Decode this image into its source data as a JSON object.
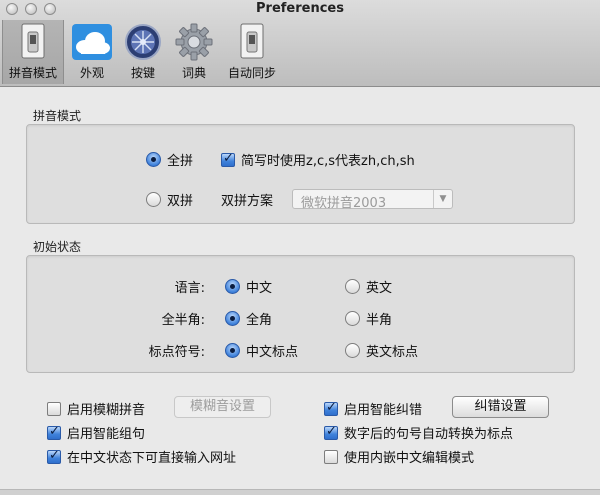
{
  "window": {
    "title": "Preferences"
  },
  "toolbar": {
    "items": [
      {
        "label": "拼音模式",
        "icon": "switch-icon",
        "selected": true
      },
      {
        "label": "外观",
        "icon": "cloud-icon",
        "selected": false
      },
      {
        "label": "按键",
        "icon": "keyboard-globe-icon",
        "selected": false
      },
      {
        "label": "词典",
        "icon": "gear-icon",
        "selected": false
      },
      {
        "label": "自动同步",
        "icon": "switch-icon",
        "selected": false
      }
    ]
  },
  "pinyin_mode": {
    "title": "拼音模式",
    "full_pinyin": {
      "label": "全拼",
      "selected": true
    },
    "abbrev_check": {
      "label": "简写时使用z,c,s代表zh,ch,sh",
      "checked": true
    },
    "double_pinyin": {
      "label": "双拼",
      "selected": false
    },
    "scheme_label": "双拼方案",
    "scheme_value": "微软拼音2003"
  },
  "initial_state": {
    "title": "初始状态",
    "language": {
      "label": "语言:",
      "opt1": "中文",
      "opt2": "英文",
      "selected": "中文"
    },
    "width": {
      "label": "全半角:",
      "opt1": "全角",
      "opt2": "半角",
      "selected": "全角"
    },
    "punct": {
      "label": "标点符号:",
      "opt1": "中文标点",
      "opt2": "英文标点",
      "selected": "中文标点"
    }
  },
  "options": {
    "fuzzy": {
      "label": "启用模糊拼音",
      "checked": false
    },
    "fuzzy_btn": "模糊音设置",
    "smart_group": {
      "label": "启用智能组句",
      "checked": true
    },
    "url_input": {
      "label": "在中文状态下可直接输入网址",
      "checked": true
    },
    "smart_correct": {
      "label": "启用智能纠错",
      "checked": true
    },
    "correct_btn": "纠错设置",
    "auto_punct": {
      "label": "数字后的句号自动转换为标点",
      "checked": true
    },
    "inline_edit": {
      "label": "使用内嵌中文编辑模式",
      "checked": false
    }
  },
  "colors": {
    "accent": "#3f82db",
    "toolbar_bg": "#c8c8c8",
    "panel_bg": "#e9e9e9"
  }
}
